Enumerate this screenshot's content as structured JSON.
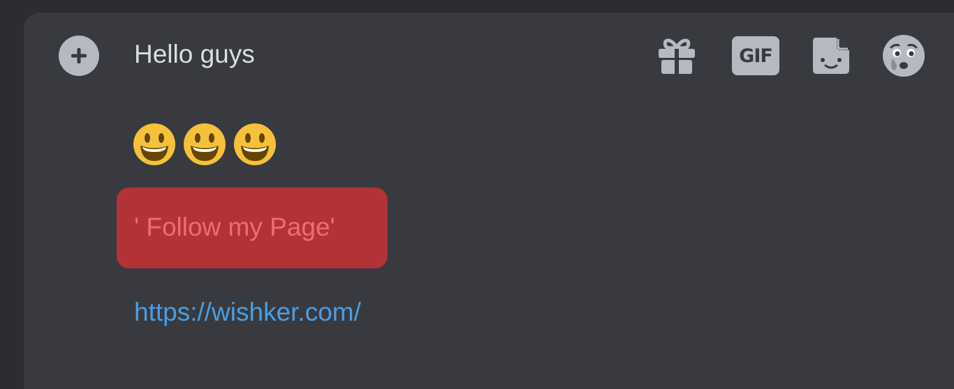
{
  "composer": {
    "message_line": "Hello guys",
    "emoji_count": 3,
    "emoji_name": "grinning-face",
    "highlight_text": "' Follow my Page'",
    "link_text": "https://wishker.com/"
  },
  "toolbar": {
    "gift_icon": "gift-icon",
    "gif_label": "GIF",
    "sticker_icon": "sticker-icon",
    "emoji_icon": "emoji-face-icon"
  },
  "colors": {
    "background": "#2b2d31",
    "composer": "#383a40",
    "text": "#dbdee1",
    "icon": "#b5bac1",
    "highlight": "#b13338",
    "highlight_text": "#ec6e6f",
    "link": "#4a9ee2",
    "emoji": "#f5c13a"
  }
}
